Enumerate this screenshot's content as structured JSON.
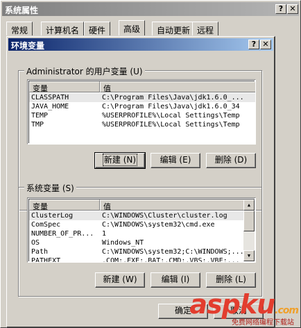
{
  "outer_window": {
    "title": "系统属性",
    "help_btn": "?",
    "close_btn": "✕",
    "tabs": [
      {
        "label": "常规"
      },
      {
        "label": "计算机名"
      },
      {
        "label": "硬件"
      },
      {
        "label": "高级"
      },
      {
        "label": "自动更新"
      },
      {
        "label": "远程"
      }
    ],
    "active_tab": "高级"
  },
  "dialog": {
    "title": "环境变量",
    "help_btn": "?",
    "close_btn": "✕",
    "user_vars": {
      "group_label": "Administrator 的用户变量 (U)",
      "col_var": "变量",
      "col_val": "值",
      "rows": [
        {
          "name": "CLASSPATH",
          "value": "C:\\Program Files\\Java\\jdk1.6.0_..."
        },
        {
          "name": "JAVA_HOME",
          "value": "C:\\Program Files\\Java\\jdk1.6.0_34"
        },
        {
          "name": "TEMP",
          "value": "%USERPROFILE%\\Local Settings\\Temp"
        },
        {
          "name": "TMP",
          "value": "%USERPROFILE%\\Local Settings\\Temp"
        }
      ],
      "selected_row": 0,
      "buttons": {
        "new": "新建 (N)",
        "edit": "编辑 (E)",
        "delete": "删除 (D)"
      }
    },
    "system_vars": {
      "group_label": "系统变量 (S)",
      "col_var": "变量",
      "col_val": "值",
      "rows": [
        {
          "name": "ClusterLog",
          "value": "C:\\WINDOWS\\Cluster\\cluster.log"
        },
        {
          "name": "ComSpec",
          "value": "C:\\WINDOWS\\system32\\cmd.exe"
        },
        {
          "name": "NUMBER_OF_PR...",
          "value": "1"
        },
        {
          "name": "OS",
          "value": "Windows_NT"
        },
        {
          "name": "Path",
          "value": "C:\\WINDOWS\\system32;C:\\WINDOWS;..."
        },
        {
          "name": "PATHEXT",
          "value": ".COM;.EXE;.BAT;.CMD;.VBS;.VBE;..."
        }
      ],
      "selected_row": 0,
      "buttons": {
        "new": "新建 (W)",
        "edit": "编辑 (I)",
        "delete": "删除 (L)"
      }
    },
    "ok_label": "确定",
    "cancel_label": "取消"
  },
  "watermark": {
    "brand_left": "asp",
    "brand_right": "ku",
    "brand_tld": ".com",
    "sub": "免费网络编程下载站"
  }
}
